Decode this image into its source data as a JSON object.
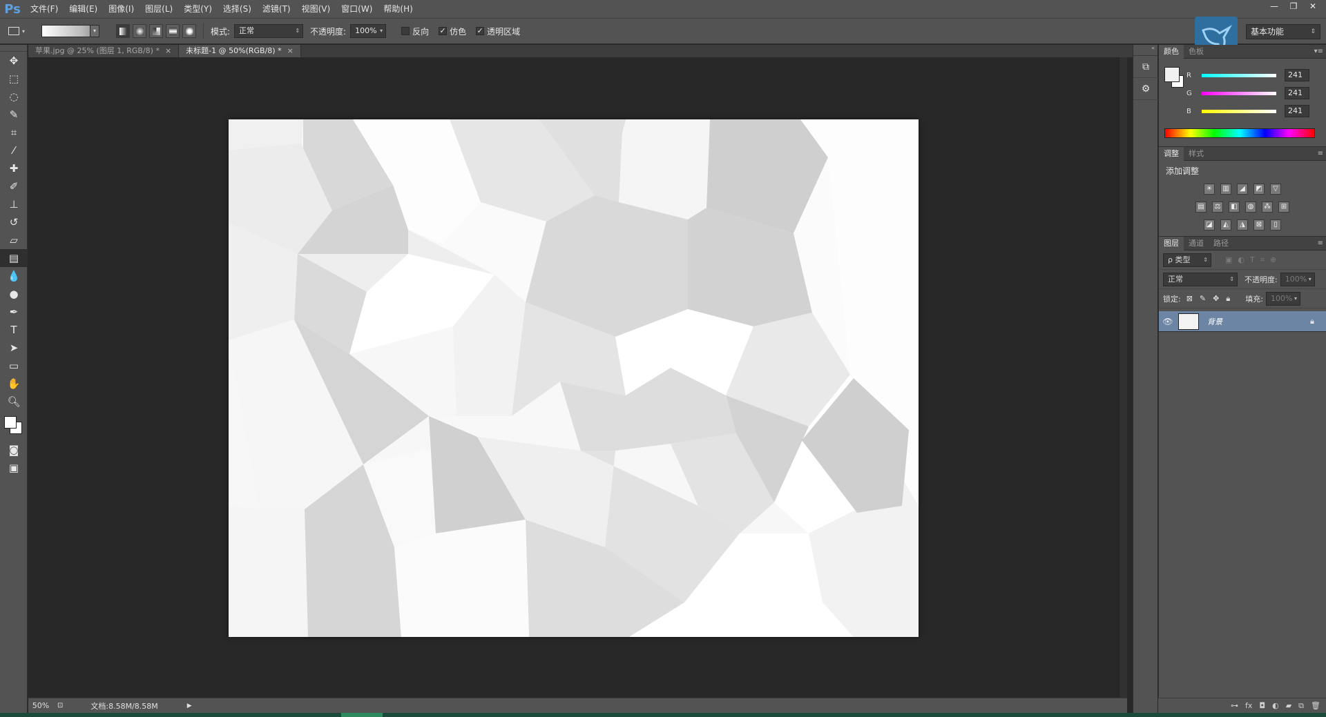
{
  "app": {
    "logo": "Ps"
  },
  "menu": [
    "文件(F)",
    "编辑(E)",
    "图像(I)",
    "图层(L)",
    "类型(Y)",
    "选择(S)",
    "滤镜(T)",
    "视图(V)",
    "窗口(W)",
    "帮助(H)"
  ],
  "window_controls": {
    "minimize": "—",
    "restore": "❐",
    "close": "✕"
  },
  "options_bar": {
    "mode_label": "模式:",
    "mode_value": "正常",
    "opacity_label": "不透明度:",
    "opacity_value": "100%",
    "reverse_label": "反向",
    "reverse_checked": false,
    "dither_label": "仿色",
    "dither_checked": true,
    "transparency_label": "透明区域",
    "transparency_checked": true,
    "workspace": "基本功能"
  },
  "doc_tabs": [
    {
      "label": "苹果.jpg @ 25% (图层 1, RGB/8) *",
      "active": false
    },
    {
      "label": "未标题-1 @ 50%(RGB/8) *",
      "active": true
    }
  ],
  "status": {
    "zoom": "50%",
    "doc_info": "文档:8.58M/8.58M"
  },
  "panels": {
    "color_tabs": [
      "颜色",
      "色板"
    ],
    "color": {
      "r_label": "R",
      "r": "241",
      "g_label": "G",
      "g": "241",
      "b_label": "B",
      "b": "241"
    },
    "adjust_tabs": [
      "调整",
      "样式"
    ],
    "adjust_title": "添加调整",
    "layers_tabs": [
      "图层",
      "通道",
      "路径"
    ],
    "layers_filter": "ρ 类型",
    "blend_mode": "正常",
    "opacity_label": "不透明度:",
    "opacity_value": "100%",
    "lock_label": "锁定:",
    "fill_label": "填充:",
    "fill_value": "100%",
    "layer_name": "背景"
  },
  "colors": {
    "accent_layer": "#6c85a5",
    "foreground": "#f1f1f1"
  }
}
